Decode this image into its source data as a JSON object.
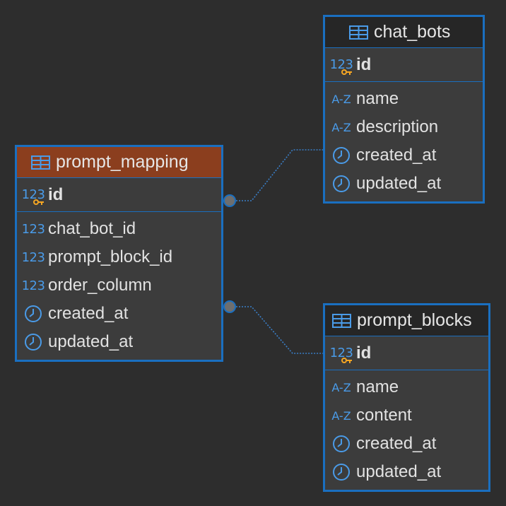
{
  "colors": {
    "background": "#2d2d2d",
    "border": "#1a6fc0",
    "header_dark": "#262626",
    "header_selected": "#8b3e1e",
    "row_bg": "#3c3c3c",
    "type_icon": "#4a9be8",
    "key_icon": "#f5a623",
    "connector": "#3a7fc8"
  },
  "entities": {
    "prompt_mapping": {
      "title": "prompt_mapping",
      "selected": true,
      "key": {
        "type_icon": "123",
        "name": "id"
      },
      "columns": [
        {
          "type_icon": "123",
          "name": "chat_bot_id"
        },
        {
          "type_icon": "123",
          "name": "prompt_block_id"
        },
        {
          "type_icon": "123",
          "name": "order_column"
        },
        {
          "type_icon": "clock-icon",
          "name": "created_at"
        },
        {
          "type_icon": "clock-icon",
          "name": "updated_at"
        }
      ]
    },
    "chat_bots": {
      "title": "chat_bots",
      "key": {
        "type_icon": "123",
        "name": "id"
      },
      "columns": [
        {
          "type_icon": "A-Z",
          "name": "name"
        },
        {
          "type_icon": "A-Z",
          "name": "description"
        },
        {
          "type_icon": "clock-icon",
          "name": "created_at"
        },
        {
          "type_icon": "clock-icon",
          "name": "updated_at"
        }
      ]
    },
    "prompt_blocks": {
      "title": "prompt_blocks",
      "key": {
        "type_icon": "123",
        "name": "id"
      },
      "columns": [
        {
          "type_icon": "A-Z",
          "name": "name"
        },
        {
          "type_icon": "A-Z",
          "name": "content"
        },
        {
          "type_icon": "clock-icon",
          "name": "created_at"
        },
        {
          "type_icon": "clock-icon",
          "name": "updated_at"
        }
      ]
    }
  }
}
